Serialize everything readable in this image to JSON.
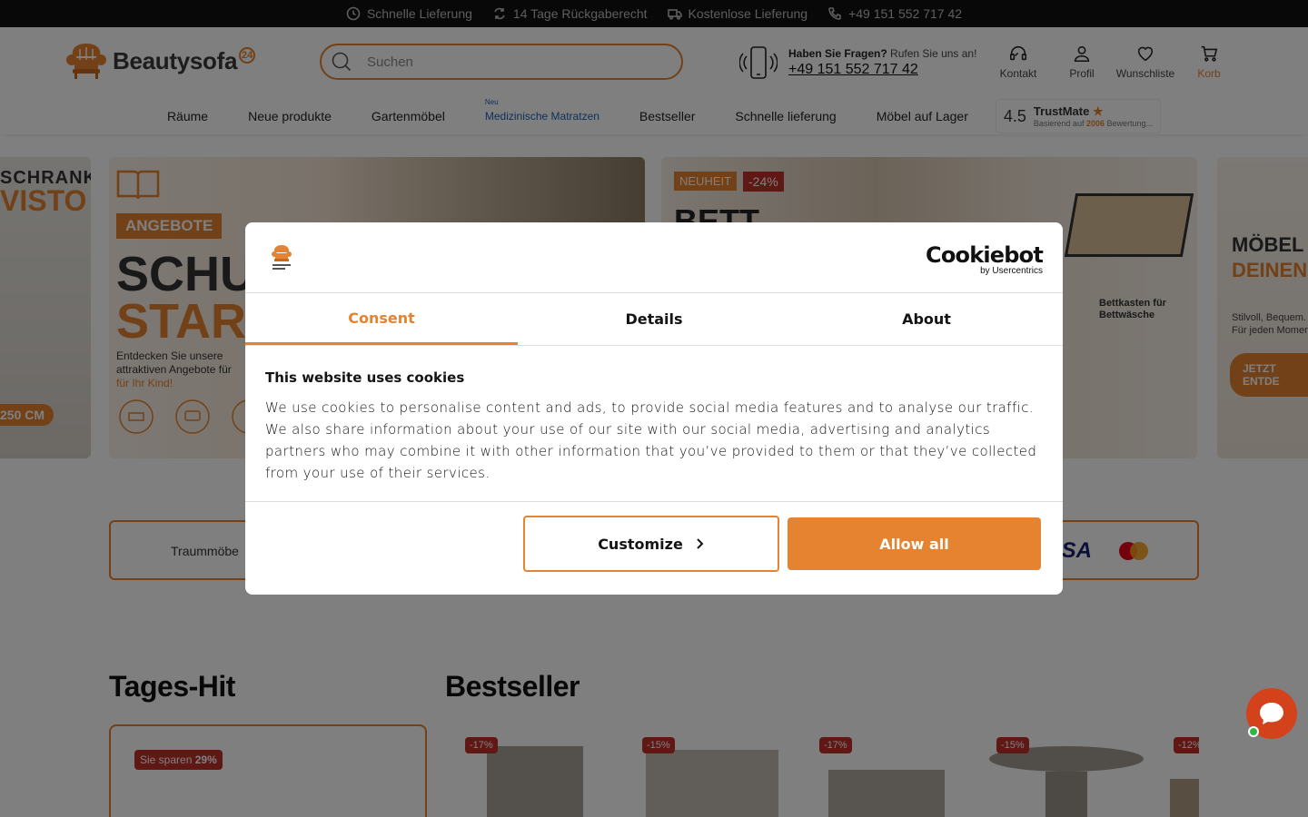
{
  "topbar": {
    "items": [
      {
        "icon": "clock-icon",
        "label": "Schnelle Lieferung"
      },
      {
        "icon": "return-icon",
        "label": "14 Tage Rückgaberecht"
      },
      {
        "icon": "truck-icon",
        "label": "Kostenlose Lieferung"
      },
      {
        "icon": "phone-icon",
        "label": "+49 151 552 717 42"
      }
    ]
  },
  "header": {
    "logo_text": "Beautysofa",
    "logo_badge": "24",
    "search_placeholder": "Suchen",
    "help_question": "Haben Sie Fragen?",
    "help_cta": "Rufen Sie uns an!",
    "help_phone": "+49 151 552 717 42",
    "icons": {
      "contact": "Kontakt",
      "profile": "Profil",
      "wishlist": "Wunschliste",
      "cart": "Korb"
    }
  },
  "nav": {
    "items": [
      "Räume",
      "Neue produkte",
      "Gartenmöbel"
    ],
    "new_badge": "Neu",
    "highlight": "Medizinische Matratzen",
    "items2": [
      "Bestseller",
      "Schnelle lieferung",
      "Möbel auf Lager"
    ],
    "trust_score": "4.5",
    "trust_brand": "TrustMate",
    "trust_sub_prefix": "Basierend auf",
    "trust_count": "2006",
    "trust_sub_suffix": "Bewertung..."
  },
  "banners": {
    "b1_line1": "SCHRANK",
    "b1_line2": "VISTO",
    "b1_size": "250 CM",
    "b2_tag": "ANGEBOTE",
    "b2_big1": "SCHU",
    "b2_big2": "STAR",
    "b2_desc": "Entdecken Sie unsere attraktiven Angebote für",
    "b2_desc2": "für Ihr Kind!",
    "b3_tag": "NEUHEIT",
    "b3_pct": "-24%",
    "b3_title": "BETT",
    "b3_feature": "Bettkasten für Bettwäsche",
    "b4_line1": "MÖBEL",
    "b4_line2": "DEINEN",
    "b4_desc": "Stilvoll, Bequem. Für jeden Momen",
    "b4_cta": "JETZT ENTDE"
  },
  "strip": {
    "text": "Traummöbe",
    "visa": "VISA"
  },
  "sections": {
    "deal_title": "Tages-Hit",
    "deal_save_prefix": "Sie sparen",
    "deal_save_pct": "29%",
    "best_title": "Bestseller",
    "discounts": [
      "-17%",
      "-15%",
      "-17%",
      "-15%",
      "-12%"
    ]
  },
  "cookie": {
    "brand": "Cookiebot",
    "brand_sub": "by Usercentrics",
    "tabs": [
      "Consent",
      "Details",
      "About"
    ],
    "active_tab": "Consent",
    "heading": "This website uses cookies",
    "body": "We use cookies to personalise content and ads, to provide social media features and to analyse our traffic. We also share information about your use of our site with our social media, advertising and analytics partners who may combine it with other information that you’ve provided to them or that they’ve collected from your use of their services.",
    "customize_label": "Customize",
    "allow_label": "Allow all"
  },
  "colors": {
    "accent": "#e58330",
    "sale": "#c0312b",
    "link_blue": "#1f5fb5"
  }
}
